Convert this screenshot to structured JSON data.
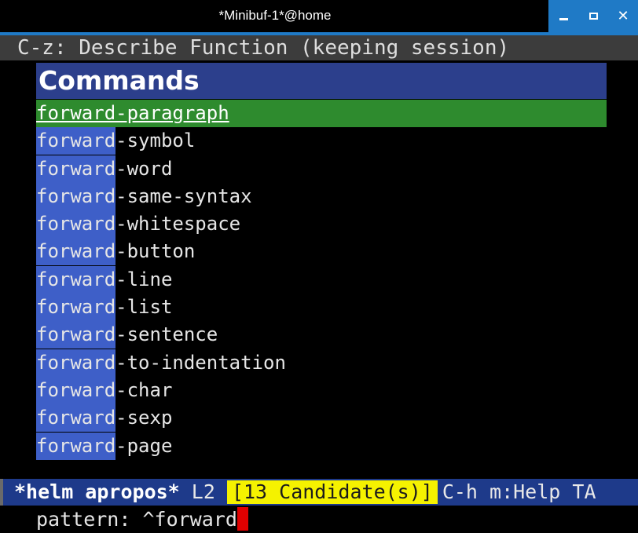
{
  "window": {
    "title": "*Minibuf-1*@home",
    "controls": [
      "minimize",
      "maximize",
      "close"
    ],
    "accent_color": "#1f7ac6"
  },
  "header": {
    "text": "C-z: Describe Function (keeping session)"
  },
  "helm": {
    "section_title": "Commands",
    "match_prefix": "forward",
    "selected": "forward-paragraph",
    "candidates": [
      {
        "prefix": "forward",
        "rest": "-symbol"
      },
      {
        "prefix": "forward",
        "rest": "-word"
      },
      {
        "prefix": "forward",
        "rest": "-same-syntax"
      },
      {
        "prefix": "forward",
        "rest": "-whitespace"
      },
      {
        "prefix": "forward",
        "rest": "-button"
      },
      {
        "prefix": "forward",
        "rest": "-line"
      },
      {
        "prefix": "forward",
        "rest": "-list"
      },
      {
        "prefix": "forward",
        "rest": "-sentence"
      },
      {
        "prefix": "forward",
        "rest": "-to-indentation"
      },
      {
        "prefix": "forward",
        "rest": "-char"
      },
      {
        "prefix": "forward",
        "rest": "-sexp"
      },
      {
        "prefix": "forward",
        "rest": "-page"
      }
    ],
    "colors": {
      "section_bg": "#2c3f8c",
      "selection_bg": "#2e8b2e",
      "match_bg": "#3e5fc8"
    }
  },
  "mode_line": {
    "buffer_name": "*helm apropos*",
    "line": "L2",
    "candidate_count": "[13 Candidate(s)]",
    "help": "C-h m:Help TA"
  },
  "minibuffer": {
    "prompt": "pattern: ",
    "input": "^forward"
  }
}
